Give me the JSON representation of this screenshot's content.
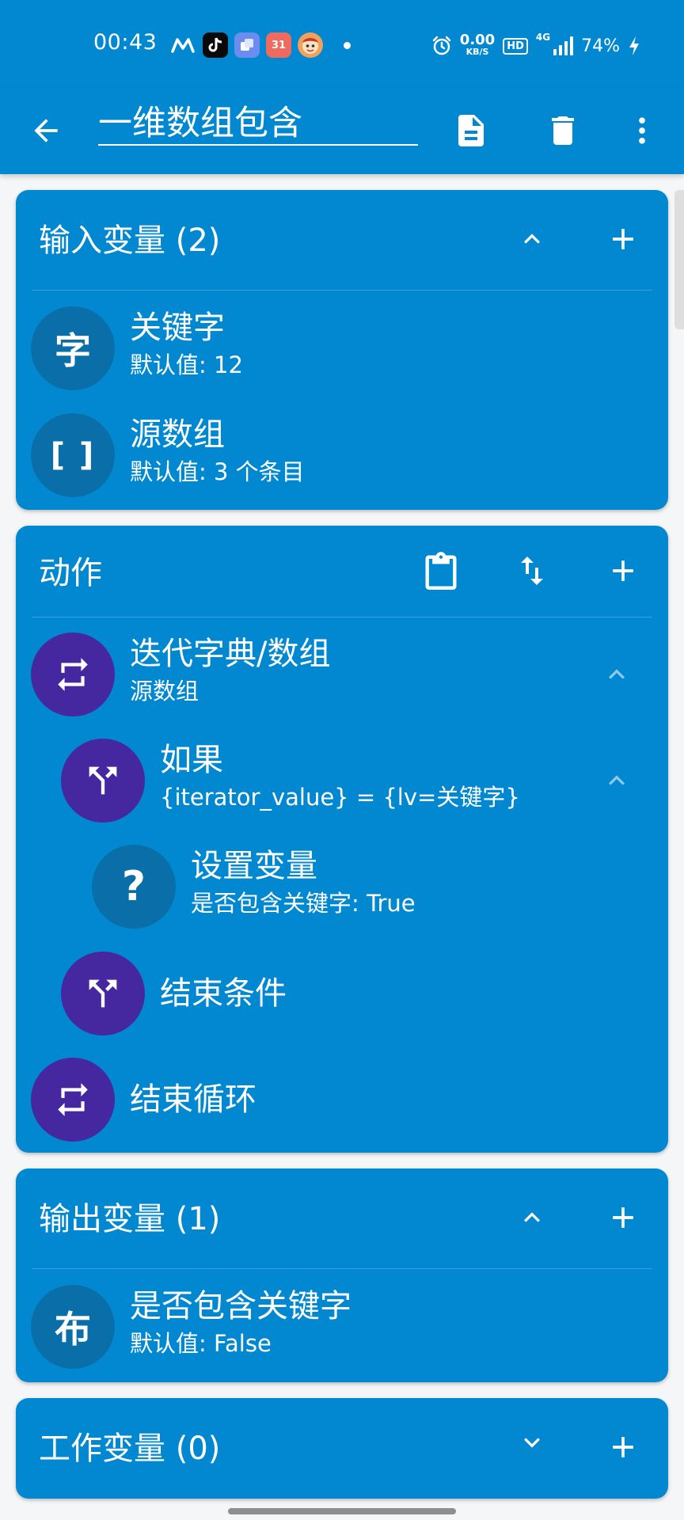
{
  "status_bar": {
    "time": "00:43",
    "network_speed_value": "0.00",
    "network_speed_unit": "KB/S",
    "hd_label": "HD",
    "network_type": "4G",
    "battery": "74%",
    "calendar_badge": "31"
  },
  "toolbar": {
    "title": "一维数组包含"
  },
  "input_vars": {
    "title": "输入变量 (2)",
    "items": [
      {
        "badge": "字",
        "name": "关键字",
        "detail": "默认值:  12"
      },
      {
        "badge": "[ ]",
        "name": "源数组",
        "detail": "默认值:  3 个条目"
      }
    ]
  },
  "actions": {
    "title": "动作",
    "items": [
      {
        "name": "迭代字典/数组",
        "detail": "源数组"
      },
      {
        "name": "如果",
        "detail": "{iterator_value} = {lv=关键字}"
      },
      {
        "badge": "?",
        "name": "设置变量",
        "detail": "是否包含关键字: True"
      },
      {
        "name": "结束条件"
      },
      {
        "name": "结束循环"
      }
    ]
  },
  "output_vars": {
    "title": "输出变量 (1)",
    "items": [
      {
        "badge": "布",
        "name": "是否包含关键字",
        "detail": "默认值:  False"
      }
    ]
  },
  "work_vars": {
    "title": "工作变量 (0)"
  },
  "colors": {
    "primary": "#0288d1",
    "avatar_dark": "#0a6fa8",
    "avatar_purple": "#4527a0",
    "background": "#f4f6f8"
  },
  "icons": {
    "back": "arrow-left-icon",
    "document": "document-icon",
    "delete": "trash-icon",
    "more": "more-vertical-icon",
    "collapse": "chevron-up-icon",
    "expand": "chevron-down-icon",
    "add": "plus-icon",
    "paste": "clipboard-icon",
    "reorder": "swap-vertical-icon",
    "loop": "repeat-icon",
    "condition": "fork-icon"
  }
}
